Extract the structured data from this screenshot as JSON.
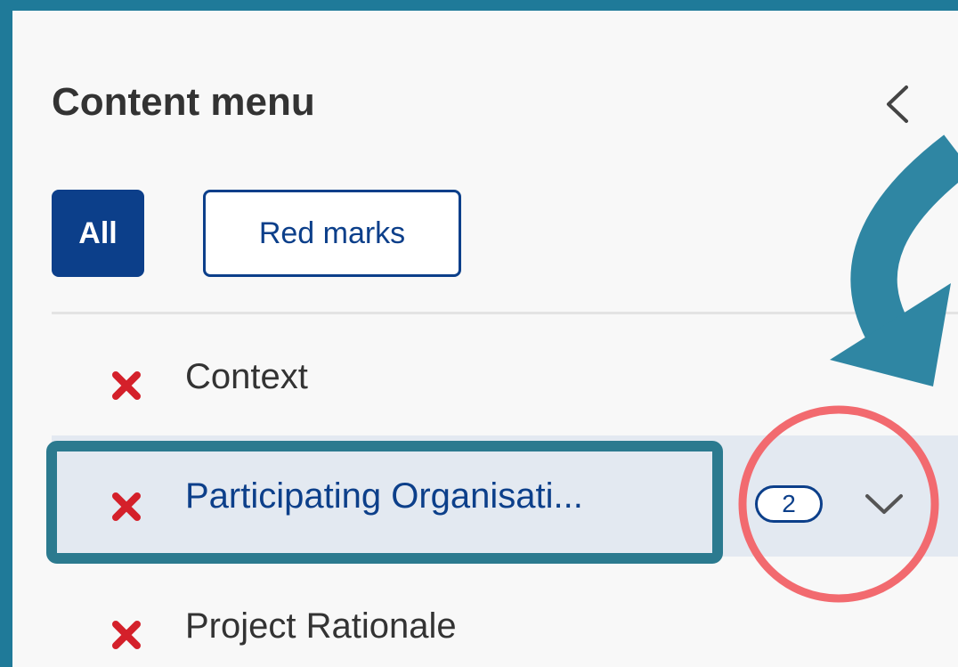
{
  "content_menu": {
    "title": "Content menu",
    "collapse_icon": "chevron-left-icon",
    "filters": {
      "all_label": "All",
      "red_marks_label": "Red marks",
      "active": "All"
    },
    "items": [
      {
        "label": "Context",
        "status_icon": "red-x-icon",
        "active": false
      },
      {
        "label": "Participating Organisati...",
        "status_icon": "red-x-icon",
        "active": true,
        "count": "2",
        "expand_icon": "chevron-down-icon"
      },
      {
        "label": "Project Rationale",
        "status_icon": "red-x-icon",
        "active": false
      }
    ]
  },
  "colors": {
    "frame": "#1f7a99",
    "primary": "#0c3f8a",
    "error_mark": "#d4202a",
    "highlight_box": "#2b7a8f",
    "annotation_circle": "#f26a6f",
    "annotation_arrow": "#2f86a3",
    "active_row": "#e3e9f1"
  }
}
